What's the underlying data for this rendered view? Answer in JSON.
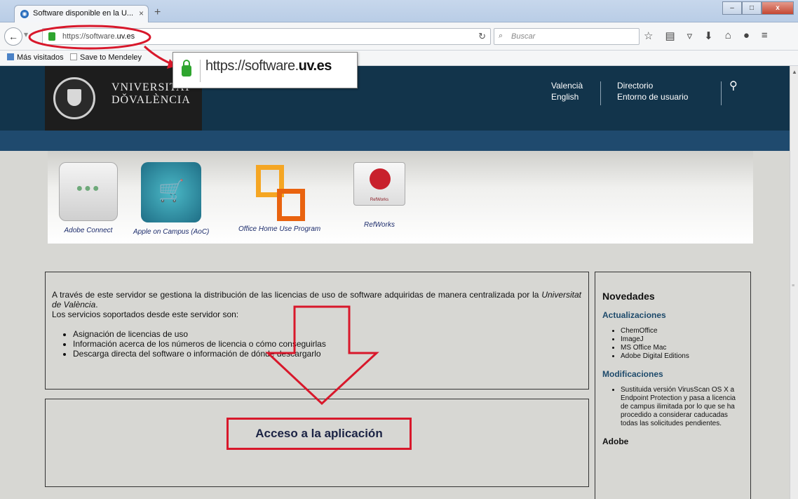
{
  "browser": {
    "tab_title": "Software disponible en la U...",
    "tab_close": "×",
    "new_tab": "+",
    "window_buttons": {
      "minimize": "–",
      "maximize": "□",
      "close": "x"
    },
    "url_prefix": "https://software.",
    "url_domain": "uv.es",
    "search_placeholder": "Buscar",
    "bookmarks": [
      "Más visitados",
      "Save to Mendeley"
    ]
  },
  "callout": {
    "url_prefix": "https://software.",
    "url_domain": "uv.es"
  },
  "header": {
    "logo_line1": "VNIVERSITAT",
    "logo_line2": "DǑVALÈNCIA",
    "lang": [
      "Valencià",
      "English"
    ],
    "links": [
      "Directorio",
      "Entorno de usuario"
    ]
  },
  "apps": [
    {
      "label": "Adobe Connect",
      "icon": "adobe-connect-icon"
    },
    {
      "label": "Apple on Campus (AoC)",
      "icon": "apple-on-campus-icon"
    },
    {
      "label": "Office Home Use Program",
      "icon": "office-icon"
    },
    {
      "label": "RefWorks",
      "icon": "refworks-icon",
      "icon_word": "RefWorks"
    }
  ],
  "main": {
    "intro_before": "A través de este servidor se gestiona la distribución de las licencias de uso de software adquiridas de manera centralizada por la ",
    "intro_italic": "Universitat de València",
    "intro_after": ".",
    "services_intro": "Los servicios soportados desde este servidor son:",
    "services": [
      "Asignación de licencias de uso",
      "Información acerca de los números de licencia o cómo conseguirlas",
      "Descarga directa del software o información de dónde descargarlo"
    ],
    "access_label": "Acceso a la aplicación"
  },
  "sidebar": {
    "title": "Novedades",
    "updates_title": "Actualizaciones",
    "updates": [
      "ChemOffice",
      "ImageJ",
      "MS Office Mac",
      "Adobe Digital Editions"
    ],
    "mods_title": "Modificaciones",
    "mods": [
      "Sustituida versión VirusScan OS X a Endpoint Protection y pasa a licencia de campus ilimitada por lo que se ha procedido a considerar caducadas todas las solicitudes pendientes."
    ],
    "adobe_title": "Adobe"
  },
  "colors": {
    "header": "#12344b",
    "band": "#1f4a6e",
    "annotation": "#d8182b",
    "link": "#1d4a6b"
  }
}
